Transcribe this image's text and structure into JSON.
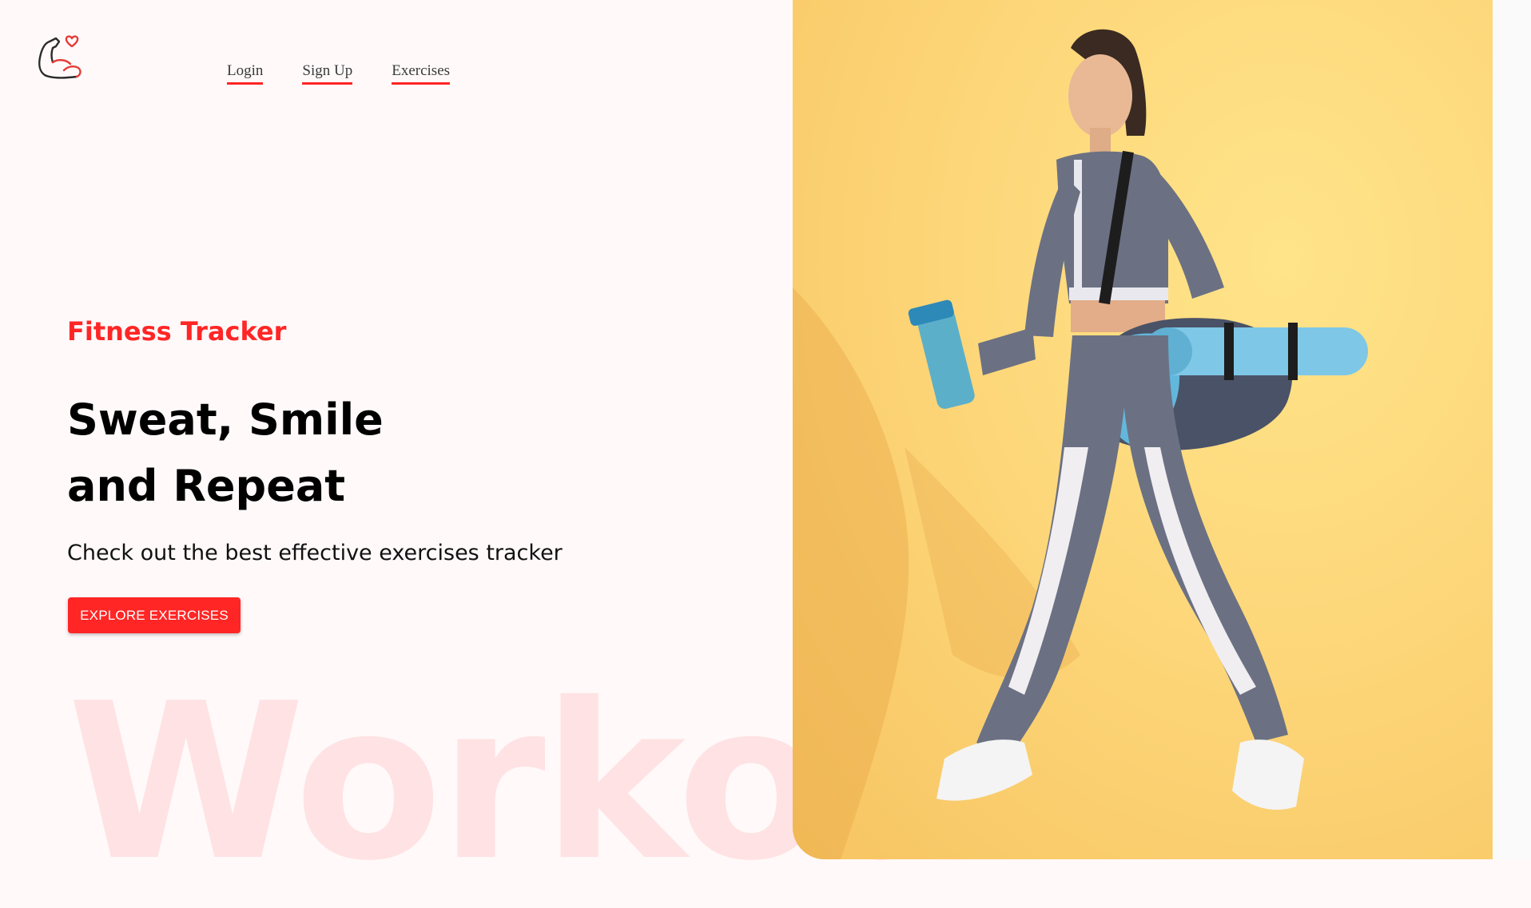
{
  "nav": {
    "links": [
      {
        "label": "Login"
      },
      {
        "label": "Sign Up"
      },
      {
        "label": "Exercises"
      }
    ]
  },
  "hero": {
    "eyebrow": "Fitness Tracker",
    "title_line1": "Sweat, Smile",
    "title_line2": "and Repeat",
    "subtitle": "Check out the best effective exercises tracker",
    "cta_label": "EXPLORE EXERCISES",
    "watermark": "Workout"
  },
  "colors": {
    "accent": "#ff2625",
    "background": "#fff9fa",
    "banner_bg": "#fdd77a"
  },
  "icons": {
    "logo": "flexed-bicep-heart-icon"
  }
}
